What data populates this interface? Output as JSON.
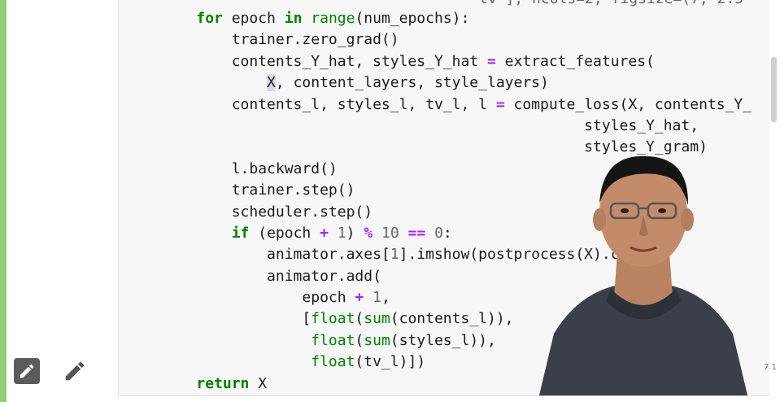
{
  "notebook": {
    "cell_index_label": "7.1",
    "partial_top_line": "tv'], ncols=2, figsize=(7, 2.5"
  },
  "code": {
    "line1": {
      "kw": "for",
      "a": " epoch ",
      "kw2": "in",
      "b": " ",
      "bi": "range",
      "c": "(num_epochs):"
    },
    "line2": "        trainer.zero_grad()",
    "line3": {
      "a": "        contents_Y_hat, styles_Y_hat ",
      "op": "=",
      "b": " extract_features("
    },
    "line4": {
      "indent": "            ",
      "cursor": "X",
      "rest": ", content_layers, style_layers)"
    },
    "line5": {
      "a": "        contents_l, styles_l, tv_l, l ",
      "op": "=",
      "b": " compute_loss(X, contents_Y_"
    },
    "line6": "                                                styles_Y_hat,",
    "line7": "                                                styles_Y_gram)",
    "line8": "        l.backward()",
    "line9": "        trainer.step()",
    "line10": "        scheduler.step()",
    "line11": {
      "indent": "        ",
      "kw": "if",
      "a": " (epoch ",
      "op": "+",
      "b": " ",
      "n1": "1",
      "c": ") ",
      "op2": "%",
      "d": " ",
      "n2": "10",
      "e": " ",
      "op3": "==",
      "f": " ",
      "n3": "0",
      "g": ":"
    },
    "line12": {
      "a": "            animator.axes[",
      "n": "1",
      "b": "].imshow(postprocess(X).cpu(),"
    },
    "line13": "            animator.add(",
    "line14": {
      "a": "                epoch ",
      "op": "+",
      "b": " ",
      "n": "1",
      "c": ","
    },
    "line15": {
      "a": "                [",
      "bi1": "float",
      "b": "(",
      "bi2": "sum",
      "c": "(contents_l)),"
    },
    "line16": {
      "a": "                 ",
      "bi1": "float",
      "b": "(",
      "bi2": "sum",
      "c": "(styles_l)),"
    },
    "line17": {
      "a": "                 ",
      "bi1": "float",
      "b": "(tv_l)])"
    },
    "line18": {
      "indent": "    ",
      "kw": "return",
      "a": " X"
    }
  },
  "toolbar": {
    "edit_icon_filled": "pencil-icon",
    "edit_icon_plain": "pencil-icon"
  },
  "colors": {
    "keyword": "#008000",
    "operator": "#aa22ff",
    "number": "#666666",
    "cell_background": "#f7f7f7",
    "left_marker": "#8fcf77"
  }
}
